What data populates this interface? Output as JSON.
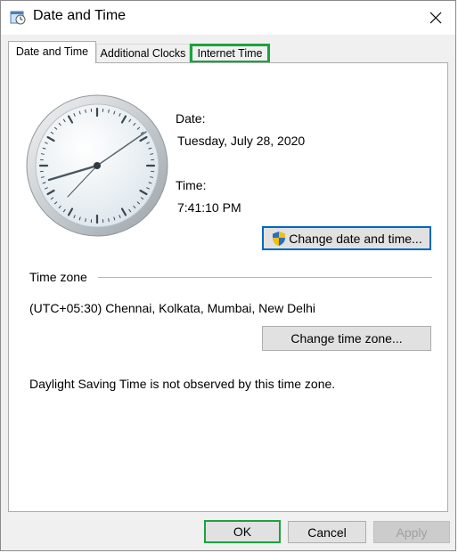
{
  "window": {
    "title": "Date and Time"
  },
  "tabs": [
    {
      "label": "Date and Time"
    },
    {
      "label": "Additional Clocks"
    },
    {
      "label": "Internet Time"
    }
  ],
  "datetime": {
    "date_label": "Date:",
    "date_value": "Tuesday, July 28, 2020",
    "time_label": "Time:",
    "time_value": "7:41:10 PM",
    "change_button": "Change date and time..."
  },
  "timezone": {
    "section_label": "Time zone",
    "value": "(UTC+05:30) Chennai, Kolkata, Mumbai, New Delhi",
    "change_button": "Change time zone...",
    "dst_note": "Daylight Saving Time is not observed by this time zone."
  },
  "footer": {
    "ok": "OK",
    "cancel": "Cancel",
    "apply": "Apply"
  },
  "colors": {
    "highlight": "#1aa33c",
    "shield_blue": "#2b6cc4",
    "shield_yellow": "#f2c200"
  }
}
